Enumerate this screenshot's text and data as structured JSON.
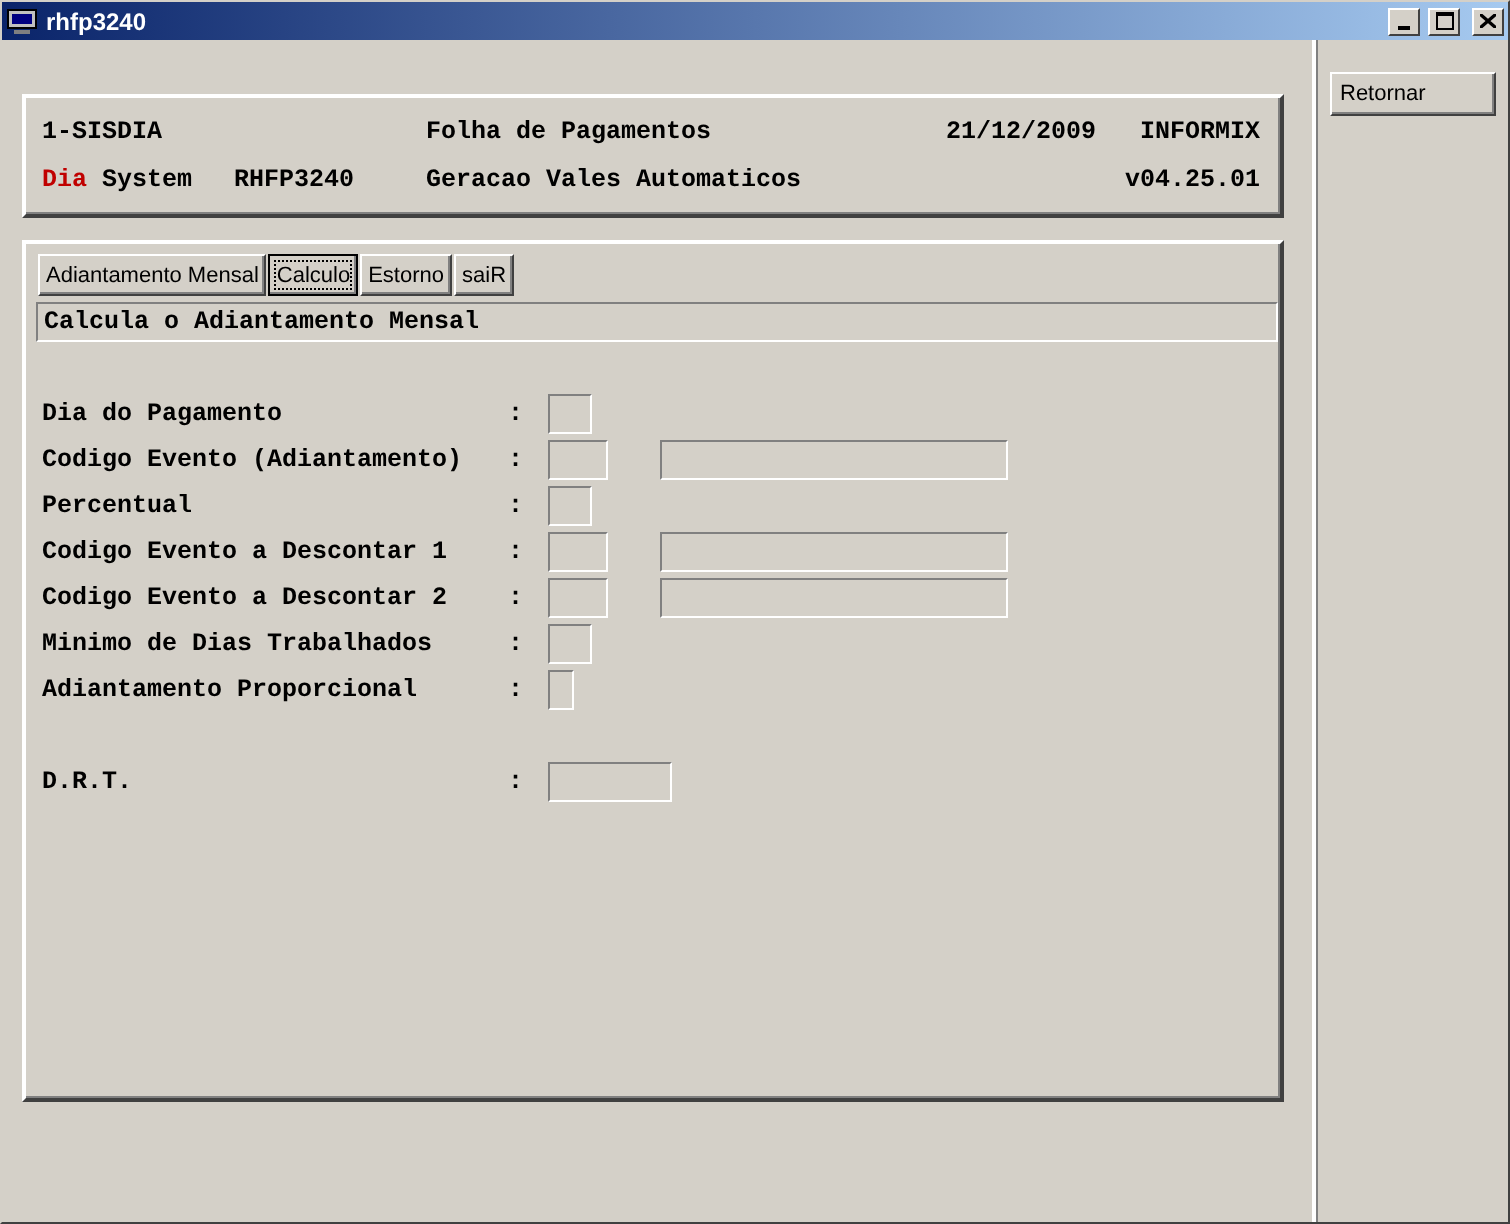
{
  "window": {
    "title": "rhfp3240"
  },
  "header": {
    "line1": {
      "system": "1-SISDIA",
      "title": "Folha de Pagamentos",
      "date": "21/12/2009",
      "db": "INFORMIX"
    },
    "line2": {
      "brand_highlight": "Dia",
      "brand_rest": "System",
      "program": "RHFP3240",
      "subtitle": "Geracao Vales Automaticos",
      "version": "v04.25.01"
    }
  },
  "menu": [
    {
      "label": "Adiantamento Mensal",
      "selected": false
    },
    {
      "label": "Calculo",
      "selected": true
    },
    {
      "label": "Estorno",
      "selected": false
    },
    {
      "label": "saiR",
      "selected": false
    }
  ],
  "description": "Calcula o Adiantamento Mensal",
  "fields": [
    {
      "label": "Dia do Pagamento",
      "separator": ":",
      "kind": "short",
      "has_description": false
    },
    {
      "label": "Codigo Evento (Adiantamento)",
      "separator": ":",
      "kind": "code",
      "has_description": true
    },
    {
      "label": "Percentual",
      "separator": ":",
      "kind": "short",
      "has_description": false
    },
    {
      "label": "Codigo Evento a Descontar 1",
      "separator": ":",
      "kind": "code",
      "has_description": true
    },
    {
      "label": "Codigo Evento a Descontar 2",
      "separator": ":",
      "kind": "code",
      "has_description": true
    },
    {
      "label": "Minimo de Dias Trabalhados",
      "separator": ":",
      "kind": "short",
      "has_description": false
    },
    {
      "label": "Adiantamento Proporcional",
      "separator": ":",
      "kind": "flag",
      "has_description": false
    }
  ],
  "drt_field": {
    "label": "D.R.T.",
    "separator": ":",
    "kind": "wide",
    "has_description": false
  },
  "side_buttons": [
    "Retornar"
  ]
}
